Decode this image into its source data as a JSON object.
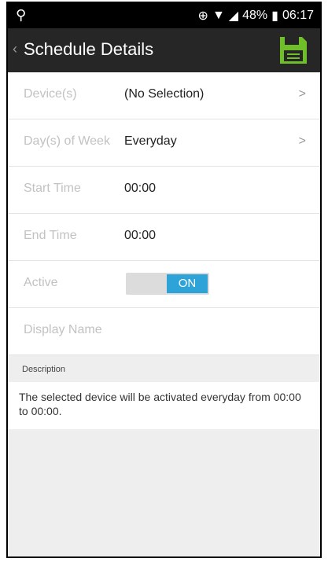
{
  "status_bar": {
    "usb_icon": "usb-icon",
    "battery_percent": "48%",
    "time": "06:17"
  },
  "app_bar": {
    "back_glyph": "‹",
    "title": "Schedule Details",
    "save_icon": "save-icon",
    "save_color": "#6fbf2b"
  },
  "rows": {
    "devices": {
      "label": "Device(s)",
      "value": "(No Selection)",
      "chevron": ">"
    },
    "days": {
      "label": "Day(s) of Week",
      "value": "Everyday",
      "chevron": ">"
    },
    "start_time": {
      "label": "Start Time",
      "value": "00:00"
    },
    "end_time": {
      "label": "End Time",
      "value": "00:00"
    },
    "active": {
      "label": "Active",
      "toggle_label": "ON",
      "toggle_on": true,
      "toggle_color": "#2ea3d8"
    },
    "display_name": {
      "label": "Display Name",
      "value": ""
    }
  },
  "description": {
    "header": "Description",
    "text": "The selected device will be activated everyday from 00:00 to 00:00."
  }
}
